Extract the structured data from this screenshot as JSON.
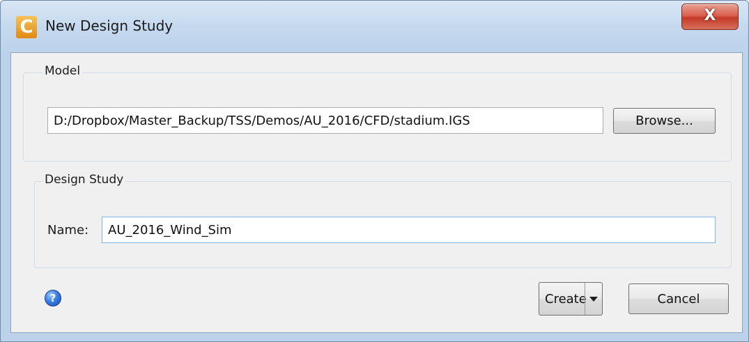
{
  "window": {
    "title": "New Design Study",
    "app_icon_glyph": "C",
    "close_glyph": "X",
    "icons": {
      "app": "cfd-app-icon",
      "close": "close-icon",
      "help": "help-icon"
    }
  },
  "model": {
    "group_label": "Model",
    "path_value": "D:/Dropbox/Master_Backup/TSS/Demos/AU_2016/CFD/stadium.IGS",
    "browse_label": "Browse..."
  },
  "design_study": {
    "group_label": "Design Study",
    "name_label": "Name:",
    "name_value": "AU_2016_Wind_Sim"
  },
  "footer": {
    "help_glyph": "?",
    "create_label": "Create",
    "cancel_label": "Cancel"
  },
  "colors": {
    "close_button": "#c53b28",
    "client_bg": "#f0f0f0",
    "focus_border": "#7eb4ea",
    "help_icon": "#3a7fe0"
  }
}
